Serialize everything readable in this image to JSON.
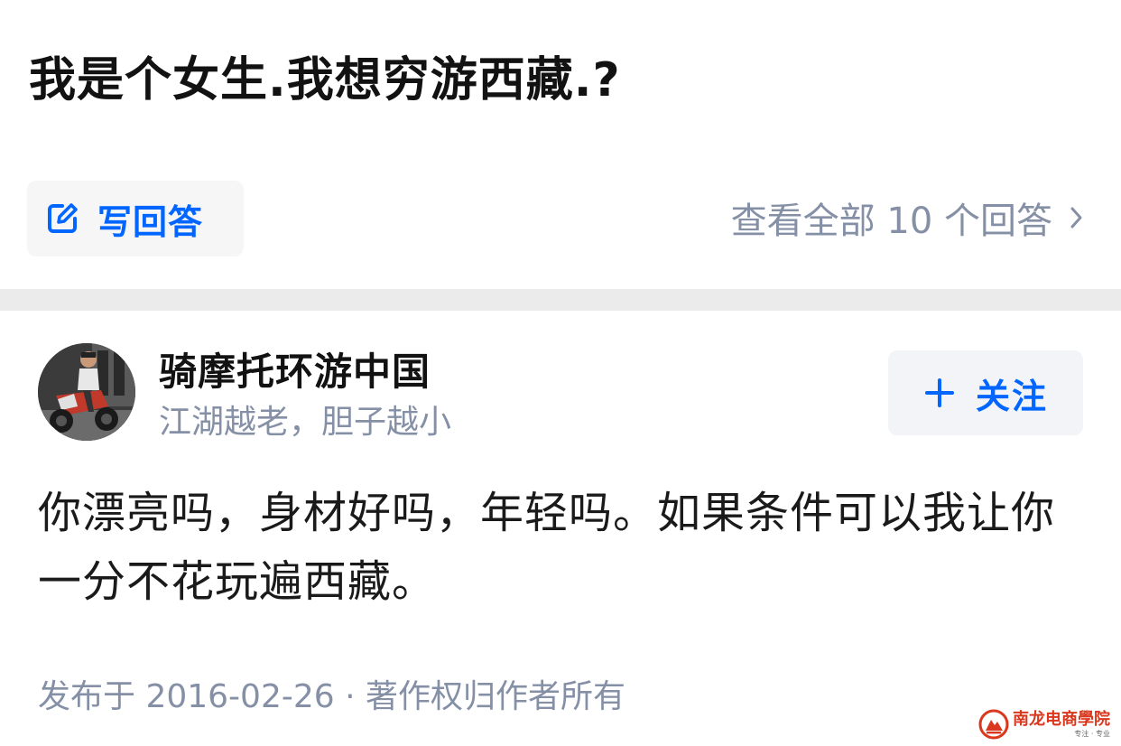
{
  "question": {
    "title": "我是个女生.我想穷游西藏.?"
  },
  "actions": {
    "write_answer_label": "写回答",
    "view_all_label": "查看全部 10 个回答",
    "accent_color": "#0066ff"
  },
  "answer": {
    "author": {
      "name": "骑摩托环游中国",
      "headline": "江湖越老，胆子越小",
      "avatar_icon": "avatar-photo"
    },
    "follow_label": "关注",
    "content": "你漂亮吗，身材好吗，年轻吗。如果条件可以我让你一分不花玩遍西藏。",
    "footer": "发布于 2016-02-26 · 著作权归作者所有"
  },
  "watermark": {
    "main": "南龙电商學院",
    "sub": "专注 · 专业"
  }
}
